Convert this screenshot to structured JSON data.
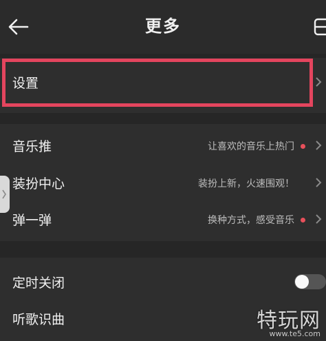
{
  "header": {
    "title": "更多",
    "back_icon": "back-arrow-icon",
    "menu_icon": "menu-icon"
  },
  "rows": {
    "settings": {
      "label": "设置"
    },
    "music_push": {
      "label": "音乐推",
      "subtitle": "让喜欢的音乐上热门"
    },
    "dress_center": {
      "label": "装扮中心",
      "subtitle": "装扮上新，火速围观！"
    },
    "bounce": {
      "label": "弹一弹",
      "subtitle": "换种方式，感受音乐"
    },
    "timer_off": {
      "label": "定时关闭",
      "toggle_on": false
    },
    "song_recognition": {
      "label": "听歌识曲"
    }
  },
  "watermark": {
    "text": "特玩网",
    "site": "www.te5.com"
  },
  "colors": {
    "highlight": "#e4455e",
    "badge_dot": "#e8505b",
    "background": "#2e2e2e"
  }
}
